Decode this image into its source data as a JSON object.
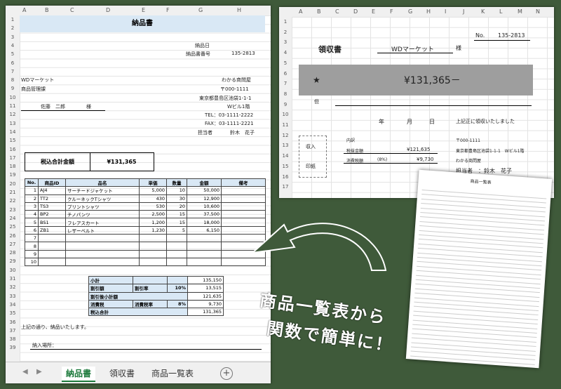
{
  "nohin": {
    "columns": [
      "A",
      "B",
      "C",
      "D",
      "E",
      "F",
      "G",
      "H"
    ],
    "rows": [
      "1",
      "2",
      "3",
      "4",
      "5",
      "6",
      "7",
      "8",
      "9",
      "10",
      "11",
      "12",
      "13",
      "14",
      "15",
      "16",
      "17",
      "18",
      "19",
      "20",
      "21",
      "22",
      "23",
      "24",
      "25",
      "26",
      "27",
      "28",
      "29",
      "30",
      "31",
      "32",
      "33",
      "34",
      "35",
      "36",
      "37",
      "38",
      "39"
    ],
    "title": "納品書",
    "date_label": "納品日",
    "number_label": "納品書番号",
    "number_value": "135-2813",
    "customer": "WDマーケット",
    "dept": "商品管理課",
    "person": "佐藤　二郎",
    "honorific": "様",
    "company": "わかる商問屋",
    "zip": "〒000-1111",
    "address": "東京都豊島区池袋1-1-1",
    "building": "Wビル1階",
    "tel": "TEL：03-1111-2222",
    "fax": "FAX：03-1111-2221",
    "staff_label": "担当者",
    "staff_name": "鈴木　花子",
    "tax_total_label": "税込合計金額",
    "tax_total_value": "¥131,365",
    "item_headers": [
      "No.",
      "商品ID",
      "品名",
      "単価",
      "数量",
      "金額",
      "備考"
    ],
    "items": [
      {
        "no": "1",
        "id": "AJ4",
        "name": "サーチードジャケット",
        "price": "5,000",
        "qty": "10",
        "amount": "50,000"
      },
      {
        "no": "2",
        "id": "TT2",
        "name": "クルーネックTシャツ",
        "price": "430",
        "qty": "30",
        "amount": "12,900"
      },
      {
        "no": "3",
        "id": "TS3",
        "name": "プリントシャツ",
        "price": "530",
        "qty": "20",
        "amount": "10,600"
      },
      {
        "no": "4",
        "id": "BP2",
        "name": "チノパンツ",
        "price": "2,500",
        "qty": "15",
        "amount": "37,500"
      },
      {
        "no": "5",
        "id": "BS1",
        "name": "フレアスカート",
        "price": "1,200",
        "qty": "15",
        "amount": "18,000"
      },
      {
        "no": "6",
        "id": "ZB1",
        "name": "レザーベルト",
        "price": "1,230",
        "qty": "5",
        "amount": "6,150"
      },
      {
        "no": "7",
        "id": "",
        "name": "",
        "price": "",
        "qty": "",
        "amount": ""
      },
      {
        "no": "8",
        "id": "",
        "name": "",
        "price": "",
        "qty": "",
        "amount": ""
      },
      {
        "no": "9",
        "id": "",
        "name": "",
        "price": "",
        "qty": "",
        "amount": ""
      },
      {
        "no": "10",
        "id": "",
        "name": "",
        "price": "",
        "qty": "",
        "amount": ""
      }
    ],
    "subtotal_label": "小計",
    "subtotal_value": "135,150",
    "discount_label": "割引額",
    "discount_rate_label": "割引率",
    "discount_rate_value": "10%",
    "discount_value": "13,515",
    "after_discount_label": "割引後小計額",
    "after_discount_value": "121,635",
    "tax_label": "消費税",
    "tax_rate_label": "消費税率",
    "tax_rate_value": "8%",
    "tax_value": "9,730",
    "grand_label": "税込合計",
    "grand_value": "131,365",
    "note": "上記の通り、納品いたします。",
    "receiver_label": "納入場所：",
    "tabs": [
      "納品書",
      "領収書",
      "商品一覧表"
    ],
    "add_tab": "+"
  },
  "ryoshu": {
    "columns": [
      "A",
      "B",
      "C",
      "D",
      "E",
      "F",
      "G",
      "H",
      "I",
      "J",
      "K",
      "L",
      "M",
      "N"
    ],
    "rows": [
      "1",
      "2",
      "3",
      "4",
      "5",
      "6",
      "7",
      "8",
      "9",
      "10",
      "11",
      "12",
      "13",
      "14",
      "15",
      "16",
      "17"
    ],
    "no_label": "No.",
    "no_value": "135-2813",
    "title": "領収書",
    "customer": "WDマーケット",
    "honorific": "様",
    "star": "★",
    "amount": "¥131,365－",
    "tadashi": "但",
    "year": "年",
    "month": "月",
    "day": "日",
    "received": "上記正に領収いたしました",
    "uchiwake": "内訳",
    "net_label": "税抜金額",
    "net_value": "¥121,635",
    "tax_label": "消費税額",
    "tax_rate": "(8%)",
    "tax_value": "¥9,730",
    "stamp1": "収入",
    "stamp2": "印紙",
    "zip": "〒000-1111",
    "address": "東京都豊島区池袋1-1-1　Wビル1階",
    "company": "わかる商問屋",
    "staff": "担当者　：鈴木　花子"
  },
  "ichiran": {
    "title": "商品一覧表"
  },
  "caption": {
    "line1": "商品一覧表から",
    "line2": "関数で簡単に！"
  }
}
